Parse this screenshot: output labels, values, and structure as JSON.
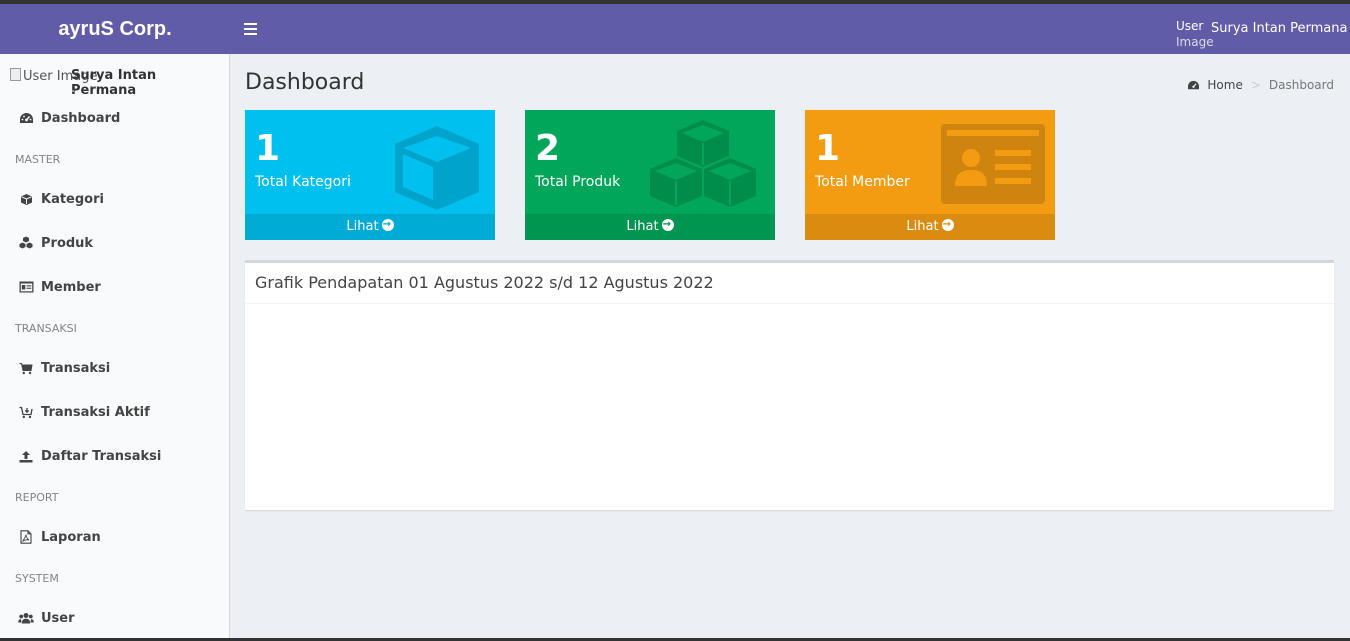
{
  "header": {
    "logo": "ayruS Corp.",
    "user_image_alt_line1": "User",
    "user_image_alt_line2": "Image",
    "user_name": "Surya Intan Permana"
  },
  "sidebar": {
    "user_image_alt": "User Image",
    "user_name": "Surya Intan Permana",
    "items": {
      "dashboard": "Dashboard",
      "master_header": "MASTER",
      "kategori": "Kategori",
      "produk": "Produk",
      "member": "Member",
      "transaksi_header": "TRANSAKSI",
      "transaksi": "Transaksi",
      "transaksi_aktif": "Transaksi Aktif",
      "daftar_transaksi": "Daftar Transaksi",
      "report_header": "REPORT",
      "laporan": "Laporan",
      "system_header": "SYSTEM",
      "user": "User"
    }
  },
  "content": {
    "title": "Dashboard",
    "breadcrumb": {
      "home": "Home",
      "current": "Dashboard"
    }
  },
  "boxes": {
    "kategori": {
      "count": "1",
      "label": "Total Kategori",
      "link": "Lihat",
      "color": "#00c0ef"
    },
    "produk": {
      "count": "2",
      "label": "Total Produk",
      "link": "Lihat",
      "color": "#00a65a"
    },
    "member": {
      "count": "1",
      "label": "Total Member",
      "link": "Lihat",
      "color": "#f39c12"
    }
  },
  "chart_box": {
    "title": "Grafik Pendapatan 01 Agustus 2022 s/d 12 Agustus 2022"
  },
  "colors": {
    "header": "#605ca8",
    "sidebar": "#f9fafc",
    "content_bg": "#ecf0f5"
  }
}
